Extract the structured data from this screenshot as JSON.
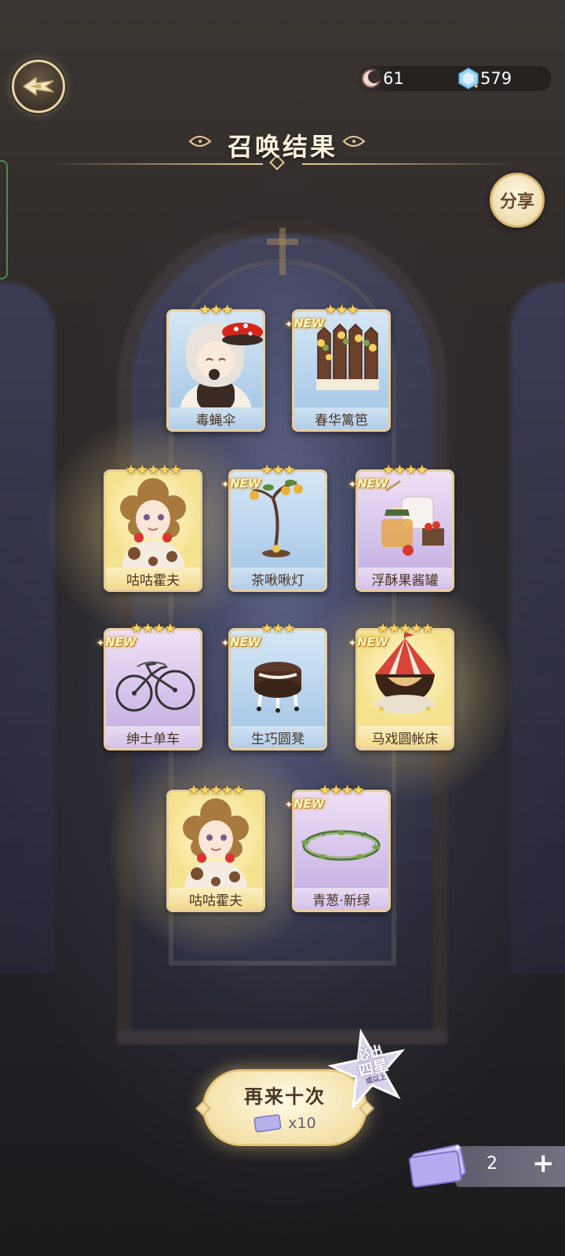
{
  "header": {
    "title": "召唤结果",
    "moon_count": "61",
    "gem_count": "579",
    "share_label": "分享"
  },
  "cards": [
    {
      "name": "毒蝇伞",
      "stars": "★★★",
      "is_new": false,
      "rarity": 3,
      "art": "mushroom-girl"
    },
    {
      "name": "春华篱笆",
      "stars": "★★★",
      "is_new": true,
      "rarity": 3,
      "art": "fence"
    },
    {
      "name": "咕咕霍夫",
      "stars": "★★★★★",
      "is_new": false,
      "rarity": 5,
      "art": "curly-girl"
    },
    {
      "name": "茶啾啾灯",
      "stars": "★★★",
      "is_new": true,
      "rarity": 3,
      "art": "lamp"
    },
    {
      "name": "浮酥果酱罐",
      "stars": "★★★★",
      "is_new": true,
      "rarity": 4,
      "art": "jam-set"
    },
    {
      "name": "绅士单车",
      "stars": "★★★★",
      "is_new": true,
      "rarity": 4,
      "art": "bicycle"
    },
    {
      "name": "生巧圆凳",
      "stars": "★★★",
      "is_new": true,
      "rarity": 3,
      "art": "stool"
    },
    {
      "name": "马戏圆帐床",
      "stars": "★★★★★",
      "is_new": true,
      "rarity": 5,
      "art": "tent-bed"
    },
    {
      "name": "咕咕霍夫",
      "stars": "★★★★★",
      "is_new": false,
      "rarity": 5,
      "art": "curly-girl"
    },
    {
      "name": "青葱·新绿",
      "stars": "★★★★",
      "is_new": true,
      "rarity": 4,
      "art": "wreath"
    }
  ],
  "new_label": "NEW",
  "retry": {
    "label": "再来十次",
    "cost": "x10"
  },
  "promo": {
    "line1": "必出",
    "line2": "四星",
    "line3": "或以上"
  },
  "ticket": {
    "count": "2",
    "plus": "+"
  },
  "colors": {
    "gold_border": "#e7cf9d",
    "star": "#ffd560",
    "rarity3": "#a9c9e8",
    "rarity4": "#c9b4e6",
    "rarity5": "#f5e28e"
  }
}
